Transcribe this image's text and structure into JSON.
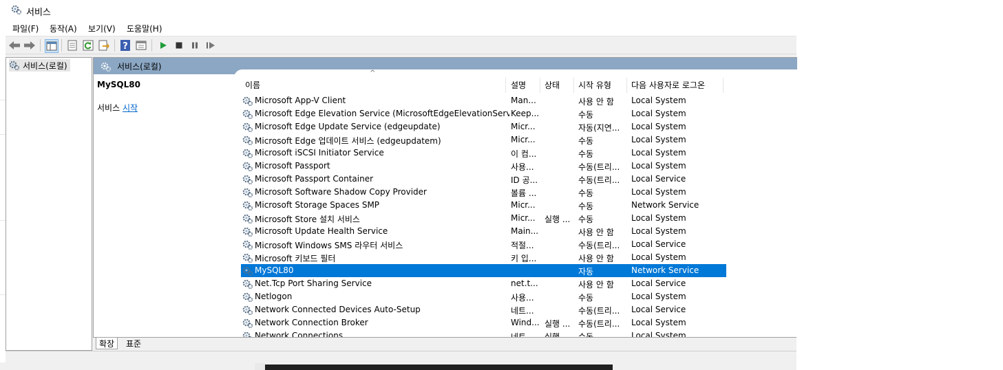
{
  "window": {
    "title": "서비스"
  },
  "menu": [
    "파일(F)",
    "동작(A)",
    "보기(V)",
    "도움말(H)"
  ],
  "toolbar": {
    "icons": [
      "back-arrow-icon",
      "forward-arrow-icon",
      "show-hide-tree-icon",
      "properties-icon",
      "refresh-icon",
      "export-list-icon",
      "help-icon",
      "console-view-icon",
      "start-service-icon",
      "stop-service-icon",
      "pause-service-icon",
      "resume-service-icon"
    ]
  },
  "tree": {
    "root_label": "서비스(로컬)"
  },
  "panel": {
    "header_title": "서비스(로컬)",
    "selected_service": "MySQL80",
    "action_prefix": "서비스",
    "action_link": "시작"
  },
  "columns": {
    "name": "이름",
    "desc": "설명",
    "status": "상태",
    "startup": "시작 유형",
    "logon": "다음 사용자로 로그온",
    "sort_glyph": "^"
  },
  "rows": [
    {
      "name": "Microsoft App-V Client",
      "desc": "Man...",
      "status": "",
      "startup": "사용 안 함",
      "logon": "Local System"
    },
    {
      "name": "Microsoft Edge Elevation Service (MicrosoftEdgeElevationService)",
      "desc": "Keep...",
      "status": "",
      "startup": "수동",
      "logon": "Local System"
    },
    {
      "name": "Microsoft Edge Update Service (edgeupdate)",
      "desc": "Micr...",
      "status": "",
      "startup": "자동(지연...",
      "logon": "Local System"
    },
    {
      "name": "Microsoft Edge 업데이트 서비스 (edgeupdatem)",
      "desc": "Micr...",
      "status": "",
      "startup": "수동",
      "logon": "Local System"
    },
    {
      "name": "Microsoft iSCSI Initiator Service",
      "desc": "이 컴...",
      "status": "",
      "startup": "수동",
      "logon": "Local System"
    },
    {
      "name": "Microsoft Passport",
      "desc": "사용...",
      "status": "",
      "startup": "수동(트리...",
      "logon": "Local System"
    },
    {
      "name": "Microsoft Passport Container",
      "desc": "ID 공...",
      "status": "",
      "startup": "수동(트리...",
      "logon": "Local Service"
    },
    {
      "name": "Microsoft Software Shadow Copy Provider",
      "desc": "볼륨 ...",
      "status": "",
      "startup": "수동",
      "logon": "Local System"
    },
    {
      "name": "Microsoft Storage Spaces SMP",
      "desc": "Micr...",
      "status": "",
      "startup": "수동",
      "logon": "Network Service"
    },
    {
      "name": "Microsoft Store 설치 서비스",
      "desc": "Micr...",
      "status": "실행 ...",
      "startup": "수동",
      "logon": "Local System"
    },
    {
      "name": "Microsoft Update Health Service",
      "desc": "Main...",
      "status": "",
      "startup": "사용 안 함",
      "logon": "Local System"
    },
    {
      "name": "Microsoft Windows SMS 라우터 서비스",
      "desc": "적절...",
      "status": "",
      "startup": "수동(트리...",
      "logon": "Local Service"
    },
    {
      "name": "Microsoft 키보드 필터",
      "desc": "키 입...",
      "status": "",
      "startup": "사용 안 함",
      "logon": "Local System"
    },
    {
      "name": "MySQL80",
      "desc": "",
      "status": "",
      "startup": "자동",
      "logon": "Network Service",
      "selected": true
    },
    {
      "name": "Net.Tcp Port Sharing Service",
      "desc": "net.t...",
      "status": "",
      "startup": "사용 안 함",
      "logon": "Local Service"
    },
    {
      "name": "Netlogon",
      "desc": "사용...",
      "status": "",
      "startup": "수동",
      "logon": "Local System"
    },
    {
      "name": "Network Connected Devices Auto-Setup",
      "desc": "네트...",
      "status": "",
      "startup": "수동(트리...",
      "logon": "Local Service"
    },
    {
      "name": "Network Connection Broker",
      "desc": "Wind...",
      "status": "실행 ...",
      "startup": "수동(트리...",
      "logon": "Local System"
    },
    {
      "name": "Network Connections",
      "desc": "네트...",
      "status": "실행 ...",
      "startup": "수동",
      "logon": "Local System"
    }
  ],
  "tabs": [
    "확장",
    "표준"
  ],
  "colors": {
    "header_blue": "#8ba7c3",
    "selection": "#0078d7",
    "link": "#0066cc"
  }
}
